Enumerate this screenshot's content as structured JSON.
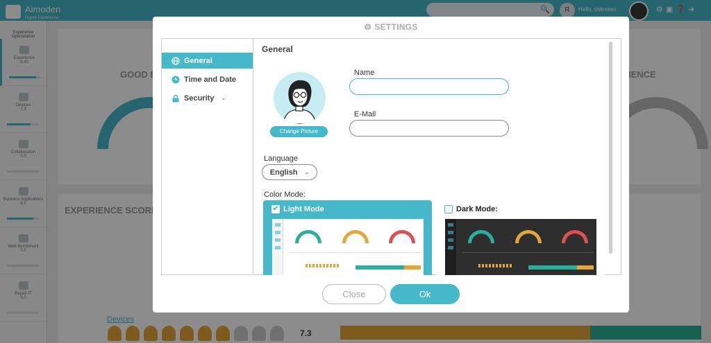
{
  "app": {
    "brand_name": "Aimoden",
    "brand_sub": "Digital Experience",
    "search_placeholder": "",
    "user_initial": "R",
    "user_name": "Hello, unknown",
    "sidebar_group": "Experience Optimization",
    "nav_items": [
      {
        "label": "Experience",
        "value": "8.40",
        "progress": 0.84
      },
      {
        "label": "Devices",
        "value": "7.3",
        "progress": 0.73
      },
      {
        "label": "Collaboration",
        "value": "0.0",
        "progress": 0
      },
      {
        "label": "Business Applications",
        "value": "8.3",
        "progress": 0.83
      },
      {
        "label": "Web Benchmark",
        "value": "0.0",
        "progress": 0
      },
      {
        "label": "Repair IT",
        "value": "0.0",
        "progress": 0
      }
    ],
    "card1_left_title": "GOOD E",
    "card1_right_title": "IENCE",
    "card2_title": "EXPERIENCE SCORE",
    "devices_link": "Devices",
    "devices_score": "7.3"
  },
  "modal": {
    "title": "SETTINGS",
    "tabs": [
      {
        "label": "General",
        "icon": "globe-icon"
      },
      {
        "label": "Time and Date",
        "icon": "clock-icon"
      },
      {
        "label": "Security",
        "icon": "lock-icon"
      }
    ],
    "section_title": "General",
    "change_picture": "Change Picture",
    "name_label": "Name",
    "name_value": "",
    "email_label": "E-Mail",
    "email_value": "",
    "language_label": "Language",
    "language_value": "English",
    "color_mode_label": "Color Mode:",
    "light_mode_label": "Light Mode",
    "dark_mode_label": "Dark Mode:",
    "light_mode_checked": true,
    "dark_mode_checked": false,
    "close_label": "Close",
    "ok_label": "Ok"
  },
  "colors": {
    "accent": "#45b8c9",
    "green": "#2ab09a",
    "amber": "#e3a63a",
    "red": "#e04f4f"
  }
}
